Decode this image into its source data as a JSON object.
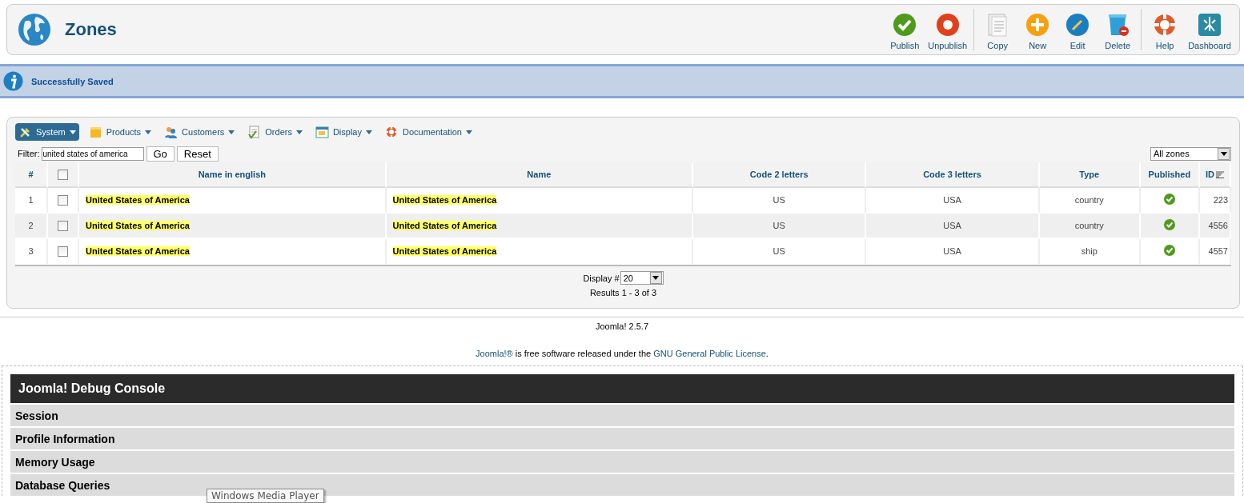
{
  "header": {
    "title": "Zones",
    "toolbar_groups": [
      [
        {
          "label": "Publish",
          "kind": "publish"
        },
        {
          "label": "Unpublish",
          "kind": "unpublish"
        }
      ],
      [
        {
          "label": "Copy",
          "kind": "copy"
        },
        {
          "label": "New",
          "kind": "new"
        },
        {
          "label": "Edit",
          "kind": "edit"
        },
        {
          "label": "Delete",
          "kind": "delete"
        }
      ],
      [
        {
          "label": "Help",
          "kind": "help"
        },
        {
          "label": "Dashboard",
          "kind": "dashboard"
        }
      ]
    ]
  },
  "message": {
    "text": "Successfully Saved"
  },
  "menu": [
    {
      "label": "System",
      "kind": "tools",
      "selected": true
    },
    {
      "label": "Products",
      "kind": "box",
      "selected": false
    },
    {
      "label": "Customers",
      "kind": "people",
      "selected": false
    },
    {
      "label": "Orders",
      "kind": "document",
      "selected": false
    },
    {
      "label": "Display",
      "kind": "window",
      "selected": false
    },
    {
      "label": "Documentation",
      "kind": "lifebuoy",
      "selected": false
    }
  ],
  "filter": {
    "label": "Filter:",
    "value": "united states of america",
    "buttons": [
      "Go",
      "Reset"
    ],
    "zone_select": "All zones"
  },
  "table": {
    "select_all_checked": false,
    "columns": [
      {
        "label": "#",
        "sorted": false
      },
      {
        "label": "Name in english",
        "sorted": false
      },
      {
        "label": "Name",
        "sorted": false
      },
      {
        "label": "Code 2 letters",
        "sorted": false
      },
      {
        "label": "Code 3 letters",
        "sorted": false
      },
      {
        "label": "Type",
        "sorted": false
      },
      {
        "label": "Published",
        "sorted": false
      },
      {
        "label": "ID",
        "sorted": true
      }
    ],
    "rows": [
      {
        "num": "1",
        "checked": false,
        "name_english": "United States of America",
        "name": "United States of America",
        "highlighted": true,
        "code2": "US",
        "code3": "USA",
        "type": "country",
        "published": true,
        "id": "223"
      },
      {
        "num": "2",
        "checked": false,
        "name_english": "United States of America",
        "name": "United States of America",
        "highlighted": true,
        "code2": "US",
        "code3": "USA",
        "type": "country",
        "published": true,
        "id": "4556"
      },
      {
        "num": "3",
        "checked": false,
        "name_english": "United States of America",
        "name": "United States of America",
        "highlighted": true,
        "code2": "US",
        "code3": "USA",
        "type": "ship",
        "published": true,
        "id": "4557"
      }
    ]
  },
  "pager": {
    "label": "Display #",
    "value": "20",
    "results": "Results 1 - 3 of 3"
  },
  "footer": {
    "version": "Joomla! 2.5.7",
    "license": [
      {
        "kind": "link",
        "text": "Joomla!®"
      },
      {
        "kind": "text",
        "text": " is free software released under the "
      },
      {
        "kind": "link",
        "text": "GNU General Public License"
      },
      {
        "kind": "text",
        "text": "."
      }
    ]
  },
  "debug": {
    "title": "Joomla! Debug Console",
    "sections": [
      "Session",
      "Profile Information",
      "Memory Usage",
      "Database Queries"
    ]
  },
  "tooltip": {
    "text": "Windows Media Player"
  }
}
